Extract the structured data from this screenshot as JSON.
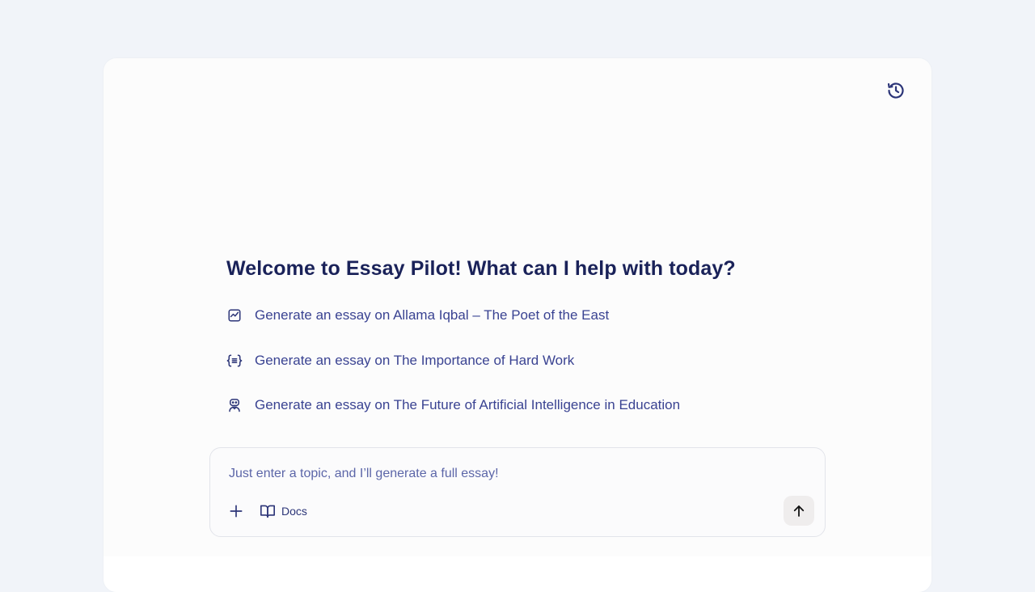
{
  "header": {
    "history_icon": "history-clock-icon"
  },
  "main": {
    "welcome_title": "Welcome to Essay Pilot! What can I help with today?",
    "suggestions": [
      {
        "icon": "chart-icon",
        "label": "Generate an essay on Allama Iqbal – The Poet of the East"
      },
      {
        "icon": "braces-icon",
        "label": "Generate an essay on The Importance of Hard Work"
      },
      {
        "icon": "robot-icon",
        "label": "Generate an essay on The Future of Artificial Intelligence in Education"
      }
    ]
  },
  "composer": {
    "placeholder": "Just enter a topic, and I’ll generate a full essay!",
    "value": "",
    "plus_icon": "plus-icon",
    "docs_label": "Docs",
    "docs_icon": "book-icon",
    "send_icon": "arrow-up-icon"
  },
  "colors": {
    "page_background": "#f1f4f9",
    "title": "#1a2259",
    "text": "#3a4392",
    "send_button_bg": "#efeded"
  }
}
